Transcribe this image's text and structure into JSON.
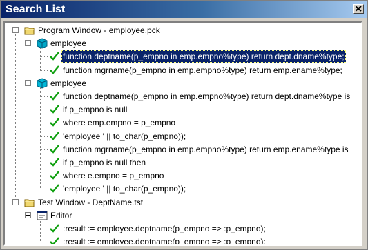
{
  "window": {
    "title": "Search List"
  },
  "tree": {
    "groups": [
      {
        "label": "Program Window - employee.pck",
        "icon": "folder-icon",
        "children": [
          {
            "label": "employee",
            "icon": "package-spec-icon",
            "items": [
              "function deptname(p_empno in emp.empno%type) return dept.dname%type;",
              "function mgrname(p_empno in emp.empno%type) return emp.ename%type;"
            ]
          },
          {
            "label": "employee",
            "icon": "package-body-icon",
            "items": [
              "function deptname(p_empno in emp.empno%type) return dept.dname%type is",
              "if p_empno is null",
              "where emp.empno = p_empno",
              "'employee ' || to_char(p_empno));",
              "function mgrname(p_empno in emp.empno%type) return emp.ename%type is",
              "if p_empno is null then",
              "where e.empno = p_empno",
              "'employee ' || to_char(p_empno));"
            ]
          }
        ]
      },
      {
        "label": "Test Window - DeptName.tst",
        "icon": "folder-icon",
        "children": [
          {
            "label": "Editor",
            "icon": "editor-icon",
            "items": [
              ":result := employee.deptname(p_empno => :p_empno);",
              ":result := employee.deptname(p_empno => :p_empno);"
            ]
          }
        ]
      }
    ],
    "selected_item": "function deptname(p_empno in emp.empno%type) return dept.dname%type;"
  }
}
